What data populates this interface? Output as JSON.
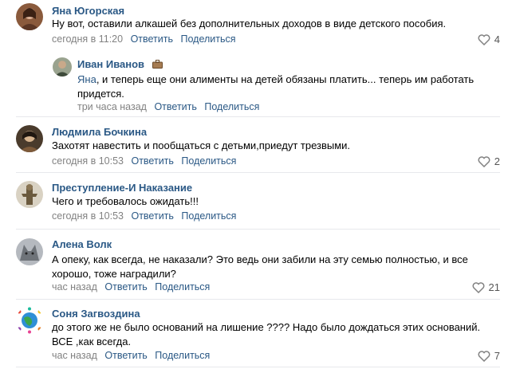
{
  "colors": {
    "link": "#2a5885",
    "meta": "#828282",
    "divider": "#e7e8ec"
  },
  "comments": [
    {
      "author": "Яна Югорская",
      "text_lines": [
        "Ну вот, оставили алкашей без дополнительных доходов в виде детского пособия."
      ],
      "time": "сегодня в 11:20",
      "reply_label": "Ответить",
      "share_label": "Поделиться",
      "likes": "4",
      "avatar_icon": "user-avatar"
    },
    {
      "author": "Иван Иванов",
      "author_badge_icon": "briefcase-icon",
      "mention": "Яна",
      "text_lines": [
        ", и теперь еще они алименты на детей обязаны платить... теперь им работать",
        "придется."
      ],
      "time": "три часа назад",
      "reply_label": "Ответить",
      "share_label": "Поделиться",
      "avatar_icon": "user-avatar"
    },
    {
      "author": "Людмила Бочкина",
      "text_lines": [
        "Захотят навестить и пообщаться с детьми,приедут трезвыми."
      ],
      "time": "сегодня в 10:53",
      "reply_label": "Ответить",
      "share_label": "Поделиться",
      "likes": "2",
      "avatar_icon": "user-avatar"
    },
    {
      "author": "Преступление-И Наказание",
      "text_lines": [
        "Чего и требовалось ожидать!!!"
      ],
      "time": "сегодня в 10:53",
      "reply_label": "Ответить",
      "share_label": "Поделиться",
      "avatar_icon": "user-avatar"
    },
    {
      "author": "Алена Волк",
      "text_lines": [
        "А опеку, как всегда, не наказали? Это ведь они забили на эту семью полностью, и все",
        "хорошо, тоже наградили?"
      ],
      "time": "час назад",
      "reply_label": "Ответить",
      "share_label": "Поделиться",
      "likes": "21",
      "avatar_icon": "user-avatar"
    },
    {
      "author": "Соня Загвоздина",
      "text_lines": [
        "до этого же не было оснований на лишение ???? Надо было дождаться этих оснований.",
        "ВСЕ ,как всегда."
      ],
      "time": "час назад",
      "reply_label": "Ответить",
      "share_label": "Поделиться",
      "likes": "7",
      "avatar_icon": "user-avatar"
    }
  ]
}
